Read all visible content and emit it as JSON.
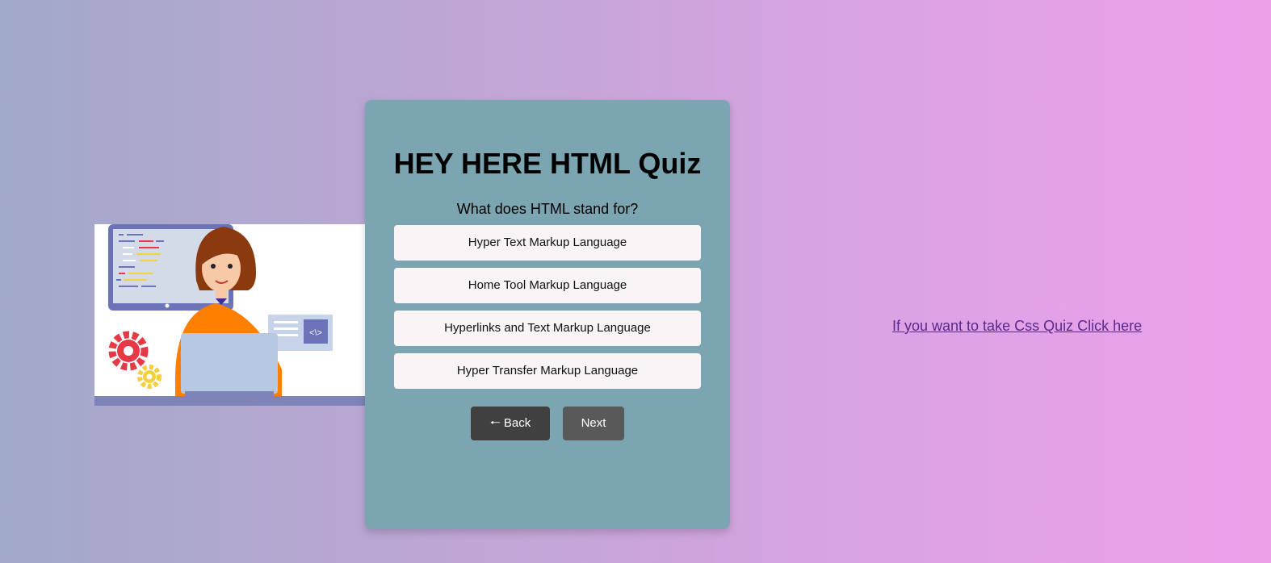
{
  "quiz": {
    "title": "HEY HERE HTML Quiz",
    "question": "What does HTML stand for?",
    "options": [
      "Hyper Text Markup Language",
      "Home Tool Markup Language",
      "Hyperlinks and Text Markup Language",
      "Hyper Transfer Markup Language"
    ],
    "back_arrow": "🠐",
    "back_label": "Back",
    "next_label": "Next"
  },
  "css_quiz_link": "If you want to take Css Quiz Click here",
  "illustration": {
    "code_icon_text": "<\\>"
  },
  "colors": {
    "card": "#7ba6b1",
    "option_bg": "#f9f4f5",
    "back_button": "#404040",
    "next_button": "#595959",
    "link": "#5a2a8a"
  }
}
